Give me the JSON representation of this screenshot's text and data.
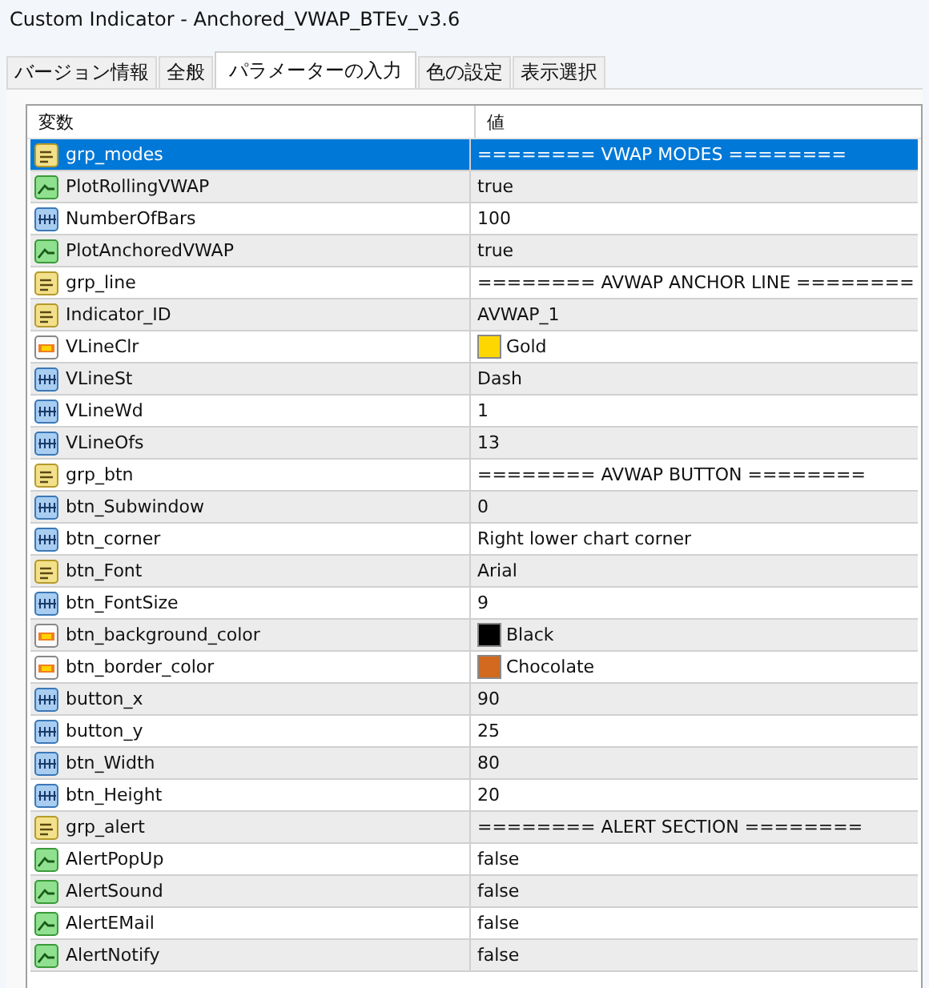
{
  "window": {
    "title": "Custom Indicator - Anchored_VWAP_BTEv_v3.6"
  },
  "tabs": [
    {
      "label": "バージョン情報",
      "selected": false
    },
    {
      "label": "全般",
      "selected": false
    },
    {
      "label": "パラメーターの入力",
      "selected": true
    },
    {
      "label": "色の設定",
      "selected": false
    },
    {
      "label": "表示選択",
      "selected": false
    }
  ],
  "table": {
    "columns": [
      "変数",
      "値"
    ],
    "rows": [
      {
        "kind": "string",
        "name": "grp_modes",
        "value": "======== VWAP MODES ========",
        "selected": true
      },
      {
        "kind": "bool",
        "name": "PlotRollingVWAP",
        "value": "true",
        "selected": false
      },
      {
        "kind": "int",
        "name": "NumberOfBars",
        "value": "100",
        "selected": false
      },
      {
        "kind": "bool",
        "name": "PlotAnchoredVWAP",
        "value": "true",
        "selected": false
      },
      {
        "kind": "string",
        "name": "grp_line",
        "value": "======== AVWAP ANCHOR LINE ========",
        "selected": false
      },
      {
        "kind": "string",
        "name": "Indicator_ID",
        "value": "AVWAP_1",
        "selected": false
      },
      {
        "kind": "color",
        "name": "VLineClr",
        "value": "Gold",
        "color": "#ffd700",
        "selected": false
      },
      {
        "kind": "int",
        "name": "VLineSt",
        "value": "Dash",
        "selected": false
      },
      {
        "kind": "int",
        "name": "VLineWd",
        "value": "1",
        "selected": false
      },
      {
        "kind": "int",
        "name": "VLineOfs",
        "value": "13",
        "selected": false
      },
      {
        "kind": "string",
        "name": "grp_btn",
        "value": "======== AVWAP BUTTON ========",
        "selected": false
      },
      {
        "kind": "int",
        "name": "btn_Subwindow",
        "value": "0",
        "selected": false
      },
      {
        "kind": "int",
        "name": "btn_corner",
        "value": "Right lower chart corner",
        "selected": false
      },
      {
        "kind": "string",
        "name": "btn_Font",
        "value": "Arial",
        "selected": false
      },
      {
        "kind": "int",
        "name": "btn_FontSize",
        "value": "9",
        "selected": false
      },
      {
        "kind": "color",
        "name": "btn_background_color",
        "value": "Black",
        "color": "#000000",
        "selected": false
      },
      {
        "kind": "color",
        "name": "btn_border_color",
        "value": "Chocolate",
        "color": "#d2691e",
        "selected": false
      },
      {
        "kind": "int",
        "name": "button_x",
        "value": "90",
        "selected": false
      },
      {
        "kind": "int",
        "name": "button_y",
        "value": "25",
        "selected": false
      },
      {
        "kind": "int",
        "name": "btn_Width",
        "value": "80",
        "selected": false
      },
      {
        "kind": "int",
        "name": "btn_Height",
        "value": "20",
        "selected": false
      },
      {
        "kind": "string",
        "name": "grp_alert",
        "value": "======== ALERT SECTION ========",
        "selected": false
      },
      {
        "kind": "bool",
        "name": "AlertPopUp",
        "value": "false",
        "selected": false
      },
      {
        "kind": "bool",
        "name": "AlertSound",
        "value": "false",
        "selected": false
      },
      {
        "kind": "bool",
        "name": "AlertEMail",
        "value": "false",
        "selected": false
      },
      {
        "kind": "bool",
        "name": "AlertNotify",
        "value": "false",
        "selected": false
      }
    ]
  }
}
